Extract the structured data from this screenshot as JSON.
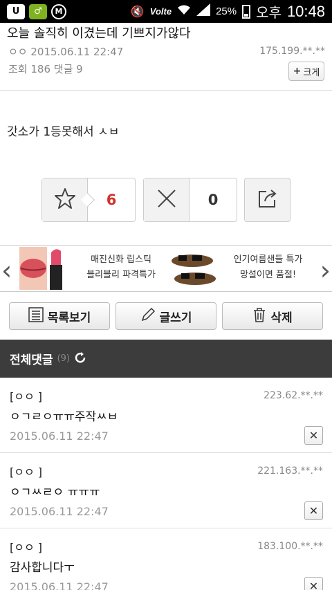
{
  "status_bar": {
    "app_icons": [
      "U",
      "♂",
      "M"
    ],
    "battery": "25%",
    "network": "Volte",
    "ampm": "오후",
    "time": "10:48"
  },
  "post": {
    "title": "오늘 솔직히 이겼는데 기쁘지가않다",
    "author_date": "ㅇㅇ 2015.06.11 22:47",
    "ip": "175.199.**.**",
    "views_comments": "조회 186 댓글 9",
    "enlarge_label": "크게",
    "body": "갓소가 1등못해서 ㅅㅂ"
  },
  "votes": {
    "like_count": "6",
    "dislike_count": "0"
  },
  "ad": {
    "item1": [
      "매진신화 립스틱",
      "블리블리 파격특가"
    ],
    "item2": [
      "인기여름샌들 특가",
      "망설이면 품절!"
    ]
  },
  "actions": {
    "list_label": "목록보기",
    "write_label": "글쓰기",
    "delete_label": "삭제"
  },
  "comments_header": {
    "title": "전체댓글",
    "count": "(9)"
  },
  "comments": [
    {
      "author": "[ㅇㅇ ]",
      "ip": "223.62.**.**",
      "text": "ㅇㄱㄹㅇㅠㅠ주작ㅆㅂ",
      "date": "2015.06.11 22:47"
    },
    {
      "author": "[ㅇㅇ ]",
      "ip": "221.163.**.**",
      "text": "ㅇㄱㅆㄹㅇ ㅠㅠㅠ",
      "date": "2015.06.11 22:47"
    },
    {
      "author": "[ㅇㅇ ]",
      "ip": "183.100.**.**",
      "text": "감사합니다ㅜ",
      "date": "2015.06.11 22:47"
    }
  ],
  "colors": {
    "like_count": "#d2322d",
    "comments_header_bg": "#3c3c3c"
  }
}
